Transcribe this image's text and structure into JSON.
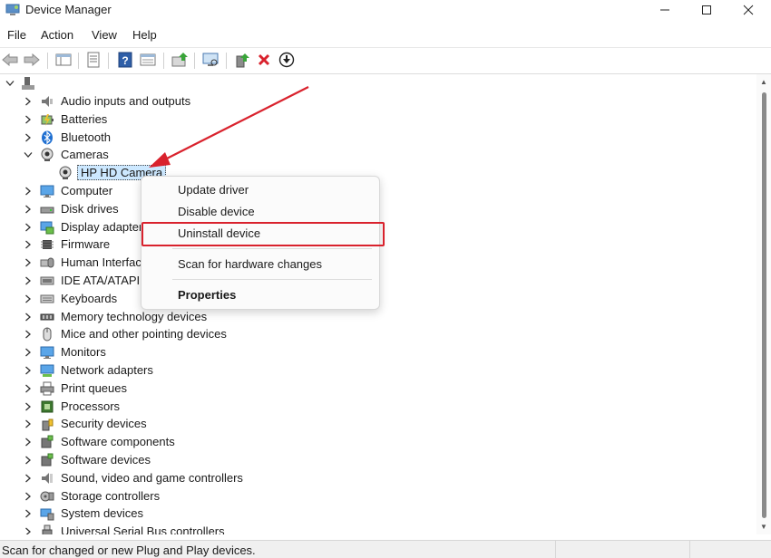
{
  "window": {
    "title": "Device Manager",
    "minimize_icon": "minimize-icon",
    "maximize_icon": "maximize-icon",
    "close_icon": "close-icon"
  },
  "menu": [
    "File",
    "Action",
    "View",
    "Help"
  ],
  "toolbar": {
    "buttons": [
      "back-icon",
      "forward-icon",
      "show-hide-console-tree-icon",
      "properties-icon",
      "help-icon",
      "view-icon",
      "update-driver-icon",
      "scan-hardware-icon",
      "enable-device-icon",
      "uninstall-icon",
      "disable-device-icon"
    ],
    "uninstall_color": "#d9222d"
  },
  "tree": {
    "categories": [
      "Audio inputs and outputs",
      "Batteries",
      "Bluetooth",
      "Cameras",
      "HP HD Camera",
      "Computer",
      "Disk drives",
      "Display adapter",
      "Firmware",
      "Human Interfac",
      "IDE ATA/ATAPI",
      "Keyboards",
      "Memory technology devices",
      "Mice and other pointing devices",
      "Monitors",
      "Network adapters",
      "Print queues",
      "Processors",
      "Security devices",
      "Software components",
      "Software devices",
      "Sound, video and game controllers",
      "Storage controllers",
      "System devices",
      "Universal Serial Bus controllers"
    ]
  },
  "context_menu": {
    "items": [
      "Update driver",
      "Disable device",
      "Uninstall device",
      "Scan for hardware changes",
      "Properties"
    ],
    "highlight_color": "#d9222d"
  },
  "status": {
    "text": "Scan for changed or new Plug and Play devices."
  },
  "annotation": {
    "arrow_color": "#d9222d"
  }
}
